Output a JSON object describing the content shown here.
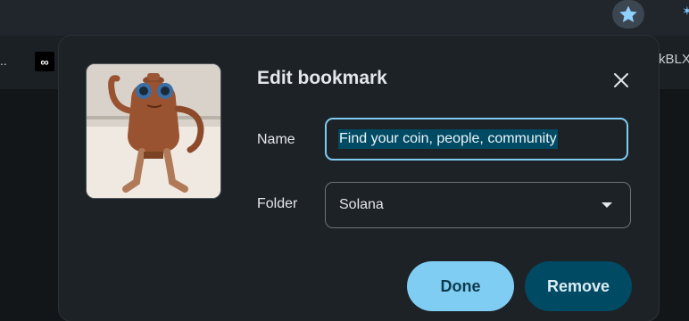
{
  "browser": {
    "bookmark_star_icon": "star-filled-icon",
    "bookmarks_bar": {
      "left_overflow": "..",
      "icon_text": "∞",
      "right_text": "kBLX:"
    }
  },
  "dialog": {
    "title": "Edit bookmark",
    "close_icon": "close-icon",
    "thumbnail": "teapot-character-image",
    "name": {
      "label": "Name",
      "value": "Find your coin, people, community"
    },
    "folder": {
      "label": "Folder",
      "value": "Solana",
      "dropdown_icon": "caret-down-icon"
    },
    "buttons": {
      "done": "Done",
      "remove": "Remove"
    }
  },
  "colors": {
    "accent": "#7fcdf3",
    "remove_button": "#004a64",
    "dialog_bg": "#1d2226"
  }
}
